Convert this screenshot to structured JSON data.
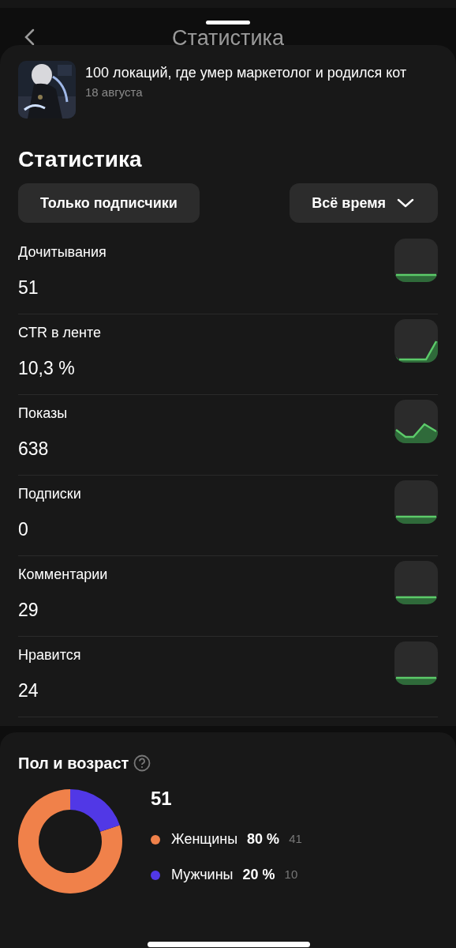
{
  "header": {
    "title": "Статистика"
  },
  "article": {
    "title": "100 локаций, где умер маркетолог и родился кот",
    "date": "18 августа"
  },
  "stats": {
    "title": "Статистика",
    "filters": [
      {
        "kind": "toggle",
        "label": "Только подписчики"
      },
      {
        "kind": "dropdown",
        "label": "Всё время"
      }
    ],
    "metrics": [
      {
        "label": "Дочитывания",
        "value": "51",
        "kind": "flat"
      },
      {
        "label": "CTR в ленте",
        "value": "10,3 %",
        "kind": "rise"
      },
      {
        "label": "Показы",
        "value": "638",
        "kind": "peak"
      },
      {
        "label": "Подписки",
        "value": "0",
        "kind": "flat"
      },
      {
        "label": "Комментарии",
        "value": "29",
        "kind": "flat"
      },
      {
        "label": "Нравится",
        "value": "24",
        "kind": "flat"
      }
    ]
  },
  "demographics": {
    "title": "Пол и возраст",
    "total": "51",
    "legend": [
      {
        "percent": "80 %",
        "count": "41",
        "color": "#f0814a"
      },
      {
        "percent": "20 %",
        "count": "10",
        "color": "#5138e6"
      }
    ],
    "chart_data": {
      "type": "donut",
      "categories": [
        "Женщины",
        "Мужчины"
      ],
      "values": [
        80,
        20
      ]
    }
  }
}
